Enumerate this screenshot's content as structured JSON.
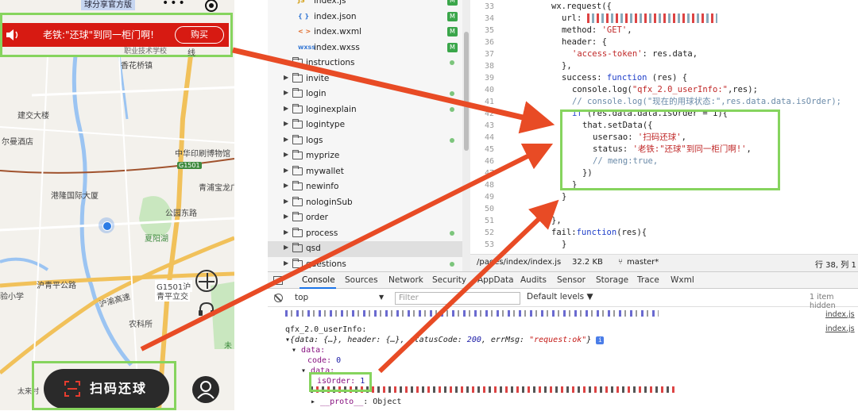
{
  "phone": {
    "title": "球分享官方版",
    "banner": {
      "text": "老铁:\"还球\"到同一柜门啊!",
      "buy_label": "购买"
    },
    "map_labels": [
      {
        "text": "香花桥镇"
      },
      {
        "text": "职业技术学校"
      },
      {
        "text": "线"
      },
      {
        "text": "建交大楼"
      },
      {
        "text": "尔曼酒店"
      },
      {
        "text": "中华印刷博物馆"
      },
      {
        "text": "G1501"
      },
      {
        "text": "港隆国际大厦"
      },
      {
        "text": "青浦宝龙广"
      },
      {
        "text": "公园东路"
      },
      {
        "text": "夏阳湖"
      },
      {
        "text": "沪青平公路"
      },
      {
        "text": "G1501沪"
      },
      {
        "text": "青平立交"
      },
      {
        "text": "验小学"
      },
      {
        "text": "沪渝高速"
      },
      {
        "text": "农科所"
      },
      {
        "text": "太来村"
      },
      {
        "text": "未"
      }
    ],
    "scan_label": "扫码还球"
  },
  "file_tree": [
    {
      "name": "index.js",
      "kind": "js",
      "badge": "M"
    },
    {
      "name": "index.json",
      "kind": "json",
      "badge": "M"
    },
    {
      "name": "index.wxml",
      "kind": "wxml",
      "badge": "M"
    },
    {
      "name": "index.wxss",
      "kind": "wxss",
      "badge": "M"
    },
    {
      "name": "instructions",
      "kind": "folder",
      "dot": true
    },
    {
      "name": "invite",
      "kind": "folder"
    },
    {
      "name": "login",
      "kind": "folder",
      "dot": true
    },
    {
      "name": "loginexplain",
      "kind": "folder",
      "dot": true
    },
    {
      "name": "logintype",
      "kind": "folder"
    },
    {
      "name": "logs",
      "kind": "folder",
      "dot": true
    },
    {
      "name": "myprize",
      "kind": "folder"
    },
    {
      "name": "mywallet",
      "kind": "folder"
    },
    {
      "name": "newinfo",
      "kind": "folder"
    },
    {
      "name": "nologinSub",
      "kind": "folder"
    },
    {
      "name": "order",
      "kind": "folder"
    },
    {
      "name": "process",
      "kind": "folder",
      "dot": true
    },
    {
      "name": "qsd",
      "kind": "folder",
      "selected": true
    },
    {
      "name": "questions",
      "kind": "folder",
      "dot": true
    }
  ],
  "editor": {
    "line_numbers": [
      "33",
      "34",
      "35",
      "36",
      "37",
      "38",
      "39",
      "40",
      "41",
      "42",
      "43",
      "44",
      "45",
      "46",
      "47",
      "48",
      "49",
      "50",
      "51",
      "52",
      "53"
    ],
    "lines": {
      "l33": "wx.request({",
      "l34a": "url: ",
      "l35a": "method: ",
      "l35b": "'GET'",
      "l36": "header: {",
      "l37a": "'access-token'",
      "l37b": ": res.data,",
      "l38": "},",
      "l39a": "success: ",
      "l39b": "function",
      "l39c": " (res) {",
      "l40a": "console.log(",
      "l40b": "\"qfx_2.0_userInfo:\"",
      "l40c": ",res);",
      "l41": "// console.log(\"现在的用球状态:\",res.data.data.isOrder);",
      "l42a": "if",
      "l42b": " (res.data.data.isOrder = 1){",
      "l43": "that.setData({",
      "l44a": "usersao: ",
      "l44b": "'扫码还球'",
      "l44c": ",",
      "l45a": "status: ",
      "l45b": "'老铁:\"还球\"到同一柜门啊!'",
      "l45c": ",",
      "l46": "// meng:true,",
      "l47": "})",
      "l48": "}",
      "l49": "}",
      "l50": "},",
      "l51a": "fail:",
      "l51b": "function",
      "l51c": "(res){",
      "l52": "}"
    },
    "status": {
      "path": "/pages/index/index.js",
      "size": "32.2 KB",
      "branch": "master*",
      "position": "行 38, 列 1"
    }
  },
  "devtools": {
    "tabs": [
      "Console",
      "Sources",
      "Network",
      "Security",
      "AppData",
      "Audits",
      "Sensor",
      "Storage",
      "Trace",
      "Wxml"
    ],
    "context": "top",
    "filter_placeholder": "Filter",
    "levels": "Default levels",
    "hidden": "1 item hidden",
    "console": {
      "log_label": "qfx_2.0_userInfo:",
      "obj_summary_a": "{data: {…}, header: {…}, statusCode: ",
      "obj_summary_b": "200",
      "obj_summary_c": ", errMsg: ",
      "obj_summary_d": "\"request:ok\"",
      "obj_summary_e": "}",
      "data_key": "data:",
      "code_key": "code:",
      "code_val": "0",
      "inner_data_key": "data:",
      "isorder_key": "isOrder:",
      "isorder_val": "1",
      "proto_key": "__proto__",
      "proto_val": ": Object",
      "src_link": "index.js"
    }
  },
  "colors": {
    "highlight": "#86d45e",
    "arrow": "#e84b25",
    "banner": "#d71a12"
  }
}
